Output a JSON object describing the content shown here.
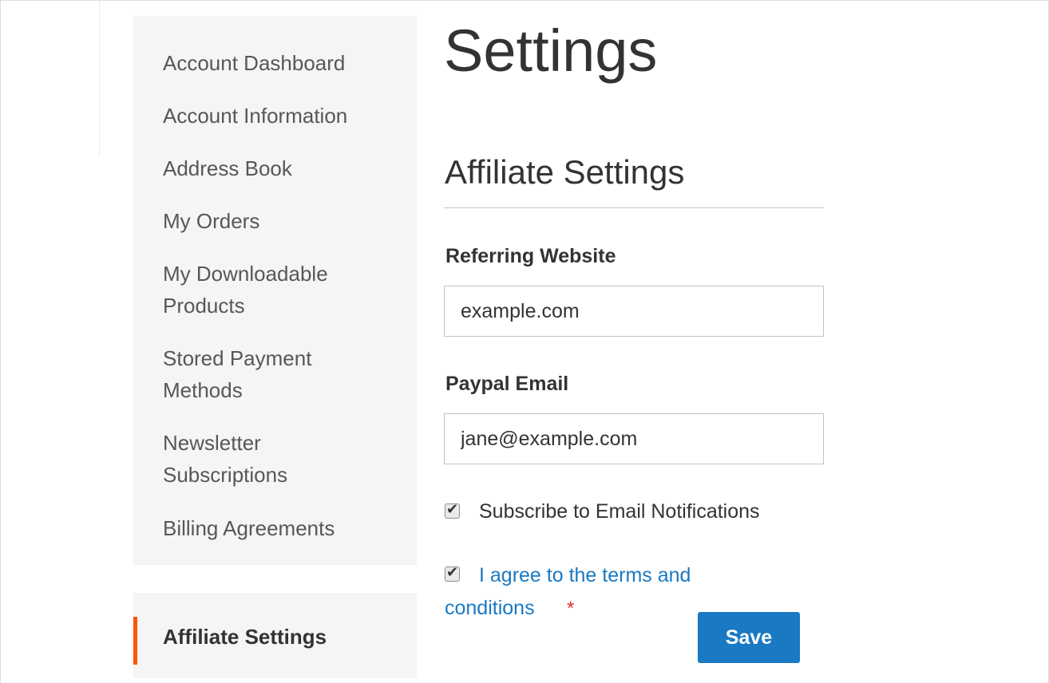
{
  "sidebar": {
    "items": [
      {
        "label": "Account Dashboard"
      },
      {
        "label": "Account Information"
      },
      {
        "label": "Address Book"
      },
      {
        "label": "My Orders"
      },
      {
        "label_line1": "My Downloadable",
        "label_line2": "Products"
      },
      {
        "label_line1": "Stored Payment",
        "label_line2": "Methods"
      },
      {
        "label_line1": "Newsletter",
        "label_line2": "Subscriptions"
      },
      {
        "label": "Billing Agreements"
      }
    ],
    "active_item": "Affiliate Settings",
    "active_color": "#ff5501"
  },
  "main": {
    "page_title": "Settings",
    "section_title": "Affiliate Settings",
    "referring_website": {
      "label": "Referring Website",
      "value": "example.com"
    },
    "paypal_email": {
      "label": "Paypal Email",
      "value": "jane@example.com"
    },
    "subscribe": {
      "label": "Subscribe to Email Notifications",
      "checked": true
    },
    "terms": {
      "label_line1": "I agree to the terms and",
      "label_line2": "conditions",
      "required_marker": "*",
      "checked": true
    },
    "save_label": "Save"
  },
  "colors": {
    "link": "#1979c3",
    "button": "#1979c3",
    "required": "#e02b27",
    "sidebar_bg": "#f5f5f5"
  }
}
